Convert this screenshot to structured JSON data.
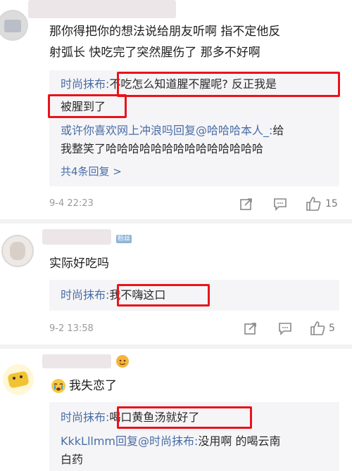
{
  "comments": [
    {
      "text_line1": "那你得把你的想法说给朋友听啊 指不定他反",
      "text_line2": "射弧长 快吃完了突然腥伤了 那多不好啊",
      "reply": {
        "author": "时尚抹布:",
        "line1_text": "不吃怎么知道腥不腥呢? 反正我是",
        "line2_text": "被腥到了"
      },
      "reply2": {
        "line1_author": "或许你喜欢网上冲浪吗回复@哈哈哈本人_:",
        "line1_tail": "给",
        "line2": "我整笑了哈哈哈哈哈哈哈哈哈哈哈哈哈哈"
      },
      "more_replies": "共4条回复 >",
      "date": "9-4 22:23",
      "likes": "15"
    },
    {
      "tag": "粉丝",
      "text": "实际好吃吗",
      "reply": {
        "author": "时尚抹布:",
        "text": "我不嗨这口"
      },
      "date": "9-2 13:58",
      "likes": "5"
    },
    {
      "text": "我失恋了",
      "reply": {
        "author": "时尚抹布:",
        "text": "喝口黄鱼汤就好了"
      },
      "reply2": {
        "prefix": "KkkLllmm回复",
        "mention": "@时尚抹布:",
        "text": "没用啊 的喝云南",
        "line2": "白药"
      }
    }
  ],
  "icons": {
    "share": "share-icon",
    "comment": "comment-icon",
    "like": "thumbs-up-icon",
    "emoji_cry": "crying-emoji-icon"
  },
  "colors": {
    "highlight": "#e8141b",
    "link": "#4a6da6"
  }
}
